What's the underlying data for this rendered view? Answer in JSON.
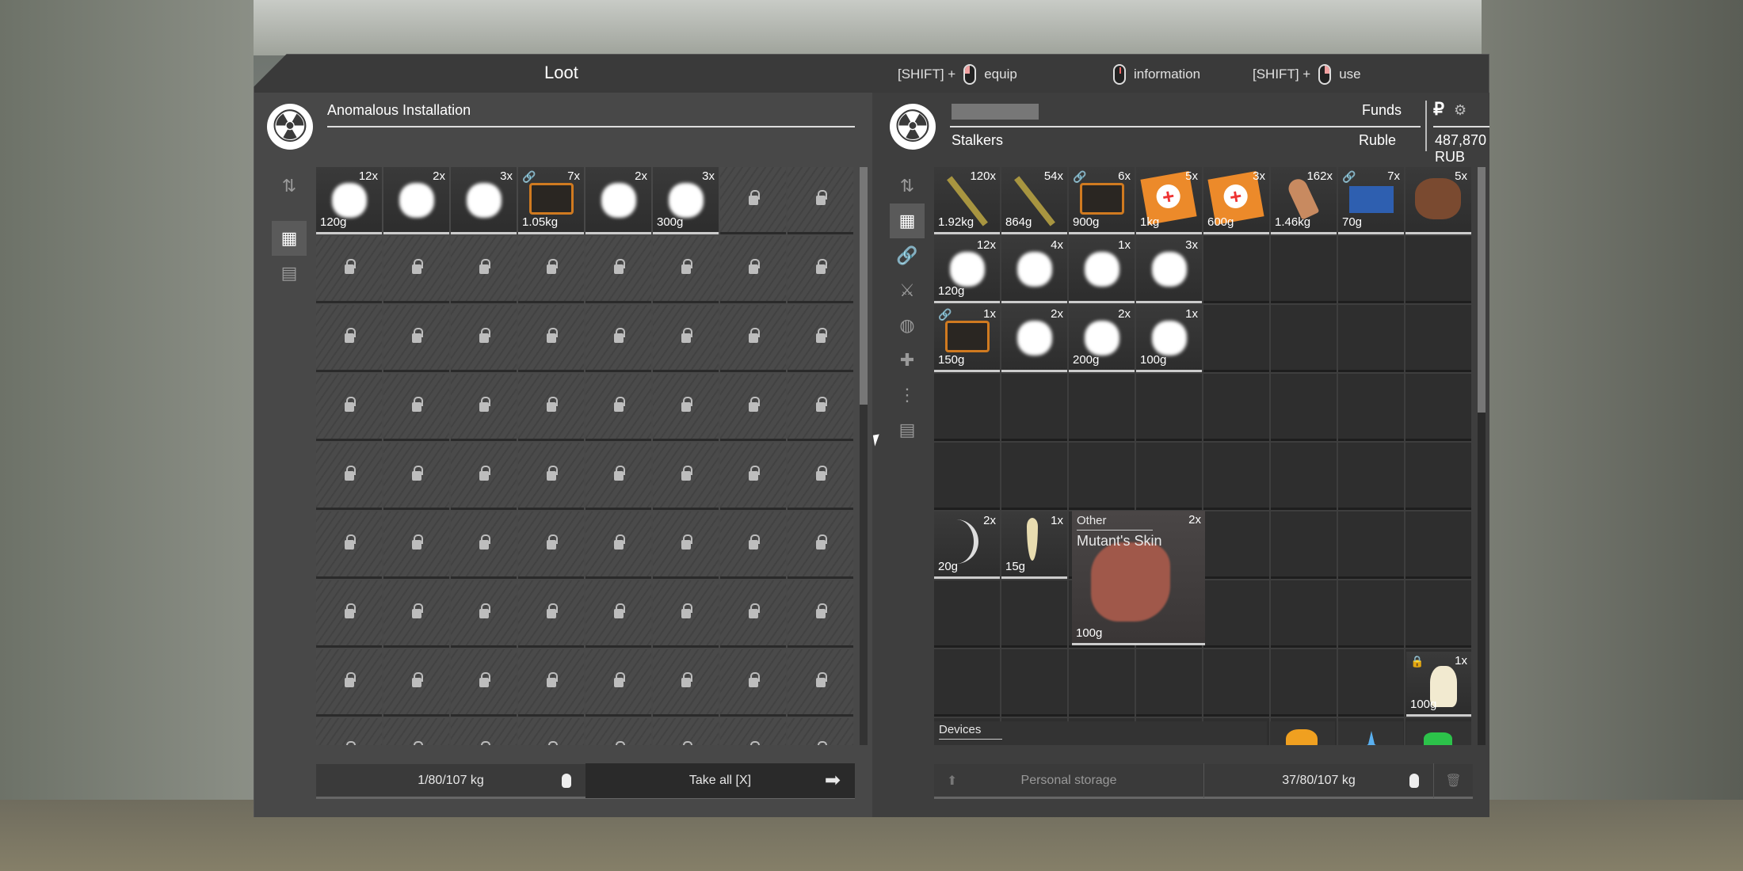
{
  "title": "Loot",
  "hints": [
    {
      "prefix": "[SHIFT] +",
      "mouse": "left-click-icon",
      "label": "equip"
    },
    {
      "prefix": "",
      "mouse": "middle-click-icon",
      "label": "information"
    },
    {
      "prefix": "[SHIFT] +",
      "mouse": "right-click-icon",
      "label": "use"
    }
  ],
  "left": {
    "container_name": "Anomalous Installation",
    "nav_icons": [
      "sort-icon",
      "grid-icon",
      "box-icon"
    ],
    "items": [
      {
        "qty": "12x",
        "weight": "120g",
        "kind": "white-artifact"
      },
      {
        "qty": "2x",
        "weight": "",
        "kind": "white-artifact"
      },
      {
        "qty": "3x",
        "weight": "",
        "kind": "white-artifact"
      },
      {
        "qty": "7x",
        "weight": "1.05kg",
        "kind": "case",
        "linked": true
      },
      {
        "qty": "2x",
        "weight": "",
        "kind": "white-artifact"
      },
      {
        "qty": "3x",
        "weight": "300g",
        "kind": "white-artifact"
      }
    ],
    "capacity": "1/80/107 kg",
    "take_all": "Take all [X]"
  },
  "right": {
    "player_name_hidden": true,
    "faction": "Stalkers",
    "funds_label": "Funds",
    "currency_label": "Ruble",
    "funds_value": "487,870 RUB",
    "currency_symbol": "₽",
    "nav_icons": [
      "sort-icon",
      "grid-icon",
      "attachments-icon",
      "weapon-icon",
      "artifact-icon",
      "medkit-icon",
      "ammo-icon",
      "box-icon"
    ],
    "items": [
      {
        "qty": "120x",
        "weight": "1.92kg",
        "kind": "rifle-round"
      },
      {
        "qty": "54x",
        "weight": "864g",
        "kind": "rifle-round"
      },
      {
        "qty": "6x",
        "weight": "900g",
        "kind": "case",
        "linked": true
      },
      {
        "qty": "5x",
        "weight": "1kg",
        "kind": "medkit"
      },
      {
        "qty": "3x",
        "weight": "600g",
        "kind": "medkit"
      },
      {
        "qty": "162x",
        "weight": "1.46kg",
        "kind": "pistol-round"
      },
      {
        "qty": "7x",
        "weight": "70g",
        "kind": "blue-item",
        "linked": true
      },
      {
        "qty": "5x",
        "weight": "",
        "kind": "hide"
      },
      {
        "qty": "12x",
        "weight": "120g",
        "kind": "white-artifact"
      },
      {
        "qty": "4x",
        "weight": "",
        "kind": "white-artifact"
      },
      {
        "qty": "1x",
        "weight": "",
        "kind": "white-artifact"
      },
      {
        "qty": "3x",
        "weight": "",
        "kind": "white-artifact"
      },
      {
        "qty": "1x",
        "weight": "150g",
        "kind": "case",
        "linked": true
      },
      {
        "qty": "2x",
        "weight": "",
        "kind": "white-artifact"
      },
      {
        "qty": "2x",
        "weight": "200g",
        "kind": "white-artifact"
      },
      {
        "qty": "1x",
        "weight": "100g",
        "kind": "white-artifact"
      },
      {
        "qty": "2x",
        "weight": "20g",
        "kind": "claw"
      },
      {
        "qty": "1x",
        "weight": "15g",
        "kind": "fang"
      }
    ],
    "tooltip": {
      "category": "Other",
      "name": "Mutant's Skin",
      "qty": "2x",
      "weight": "100g"
    },
    "bag": {
      "qty": "1x",
      "weight": "100g"
    },
    "devices_label": "Devices",
    "storage_label": "Personal storage",
    "capacity": "37/80/107 kg"
  }
}
